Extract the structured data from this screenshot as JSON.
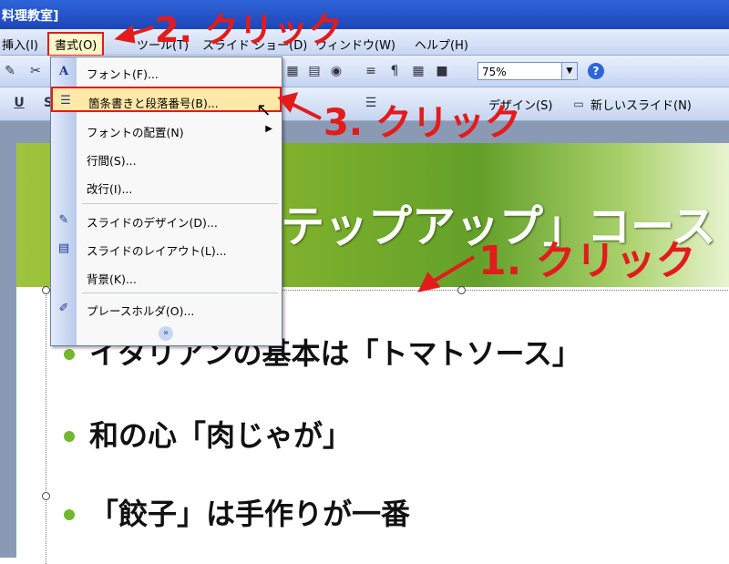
{
  "titlebar": {
    "title": "料理教室]"
  },
  "menubar": {
    "items": [
      "挿入(I)",
      "書式(O)",
      "ツール(T)",
      "スライド ショー(D)",
      "ウィンドウ(W)",
      "ヘルプ(H)"
    ]
  },
  "toolbar": {
    "zoom": "75%",
    "design_label": "デザイン(S)",
    "new_slide_label": "新しいスライド(N)"
  },
  "format_menu": {
    "items": [
      {
        "label": "フォント(F)...",
        "icon": "font-A-icon"
      },
      {
        "label": "箇条書きと段落番号(B)...",
        "icon": "bullets-icon",
        "highlighted": true
      },
      {
        "label": "フォントの配置(N)",
        "has_submenu": true
      },
      {
        "label": "行間(S)..."
      },
      {
        "label": "改行(I)..."
      },
      {
        "label": "スライドのデザイン(D)...",
        "icon": "slide-design-icon"
      },
      {
        "label": "スライドのレイアウト(L)...",
        "icon": "slide-layout-icon"
      },
      {
        "label": "背景(K)..."
      },
      {
        "label": "プレースホルダ(O)...",
        "icon": "placeholder-icon"
      }
    ]
  },
  "slide": {
    "title": "テップアップ」コース",
    "bullets": [
      "イタリアンの基本は「トマトソース」",
      "和の心「肉じゃが」",
      "「餃子」は手作りが一番"
    ]
  },
  "annotations": {
    "step1": "1. クリック",
    "step2": "2. クリック",
    "step3": "3. クリック",
    "color": "#e31b1b"
  }
}
